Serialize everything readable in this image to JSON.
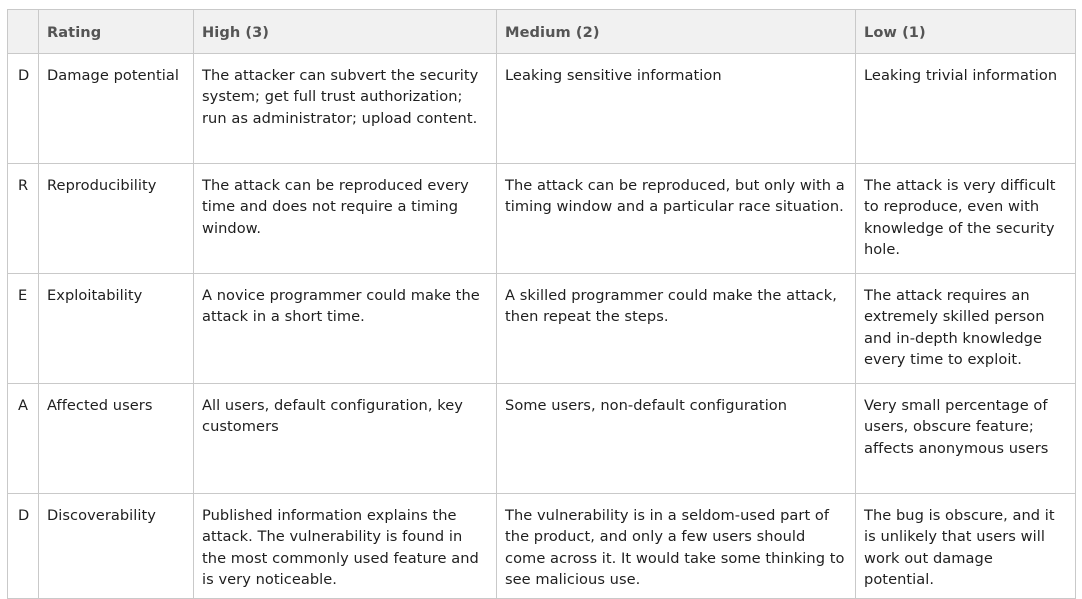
{
  "header": {
    "blank": "",
    "rating": "Rating",
    "high": "High (3)",
    "medium": "Medium (2)",
    "low": "Low (1)"
  },
  "rows": [
    {
      "letter": "D",
      "category": "Damage potential",
      "high": "The attacker can subvert the security system; get full trust authorization; run as administrator; upload content.",
      "medium": "Leaking sensitive information",
      "low": "Leaking trivial information"
    },
    {
      "letter": "R",
      "category": "Reproducibility",
      "high": "The attack can be reproduced every time and does not require a timing window.",
      "medium": "The attack can be reproduced, but only with a timing window and a particular race situation.",
      "low": "The attack is very difficult to reproduce, even with knowledge of the security hole."
    },
    {
      "letter": "E",
      "category": "Exploitability",
      "high": "A novice programmer could make the attack in a short time.",
      "medium": "A skilled programmer could make the attack, then repeat the steps.",
      "low": "The attack requires an extremely skilled person and in-depth knowledge every time to exploit."
    },
    {
      "letter": "A",
      "category": "Affected users",
      "high": "All users, default configuration, key customers",
      "medium": "Some users, non-default configuration",
      "low": "Very small percentage of users, obscure feature; affects anonymous users"
    },
    {
      "letter": "D",
      "category": "Discoverability",
      "high": "Published information explains the attack. The vulnerability is found in the most commonly used feature and is very noticeable.",
      "medium": "The vulnerability is in a seldom-used part of the product, and only a few users should come across it. It would take some thinking to see malicious use.",
      "low": "The bug is obscure, and it is unlikely that users will work out damage potential."
    }
  ]
}
